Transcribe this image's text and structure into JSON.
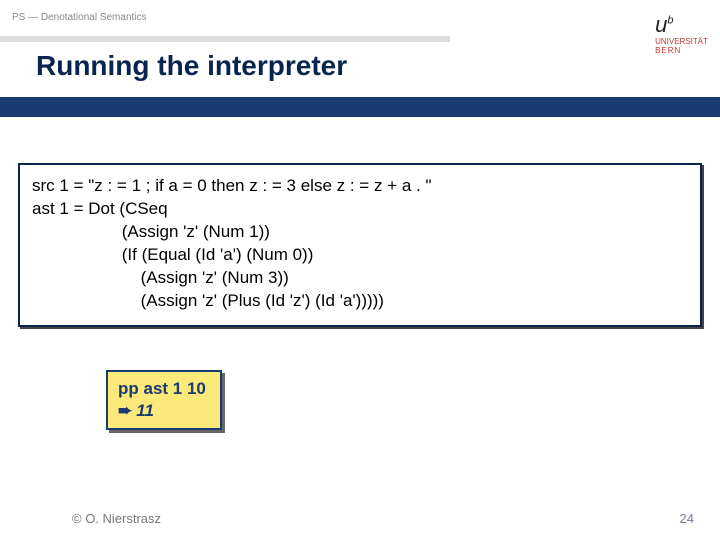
{
  "header": {
    "course": "PS — Denotational Semantics"
  },
  "logo": {
    "ub": "u",
    "sup": "b",
    "line1": "UNIVERSITÄT",
    "line2": "BERN"
  },
  "title": "Running the interpreter",
  "code": {
    "l1": "src 1 = \"z : = 1 ; if a = 0 then z : = 3 else z : = z + a . \"",
    "l2": "ast 1 = Dot (CSeq",
    "l3": "                   (Assign 'z' (Num 1))",
    "l4": "                   (If (Equal (Id 'a') (Num 0))",
    "l5": "                       (Assign 'z' (Num 3))",
    "l6": "                       (Assign 'z' (Plus (Id 'z') (Id 'a')))))"
  },
  "evalbox": {
    "cmd": "pp ast 1 10",
    "arrow": "➨",
    "result": "11"
  },
  "footer": {
    "copyright": "© O. Nierstrasz",
    "page": "24"
  }
}
